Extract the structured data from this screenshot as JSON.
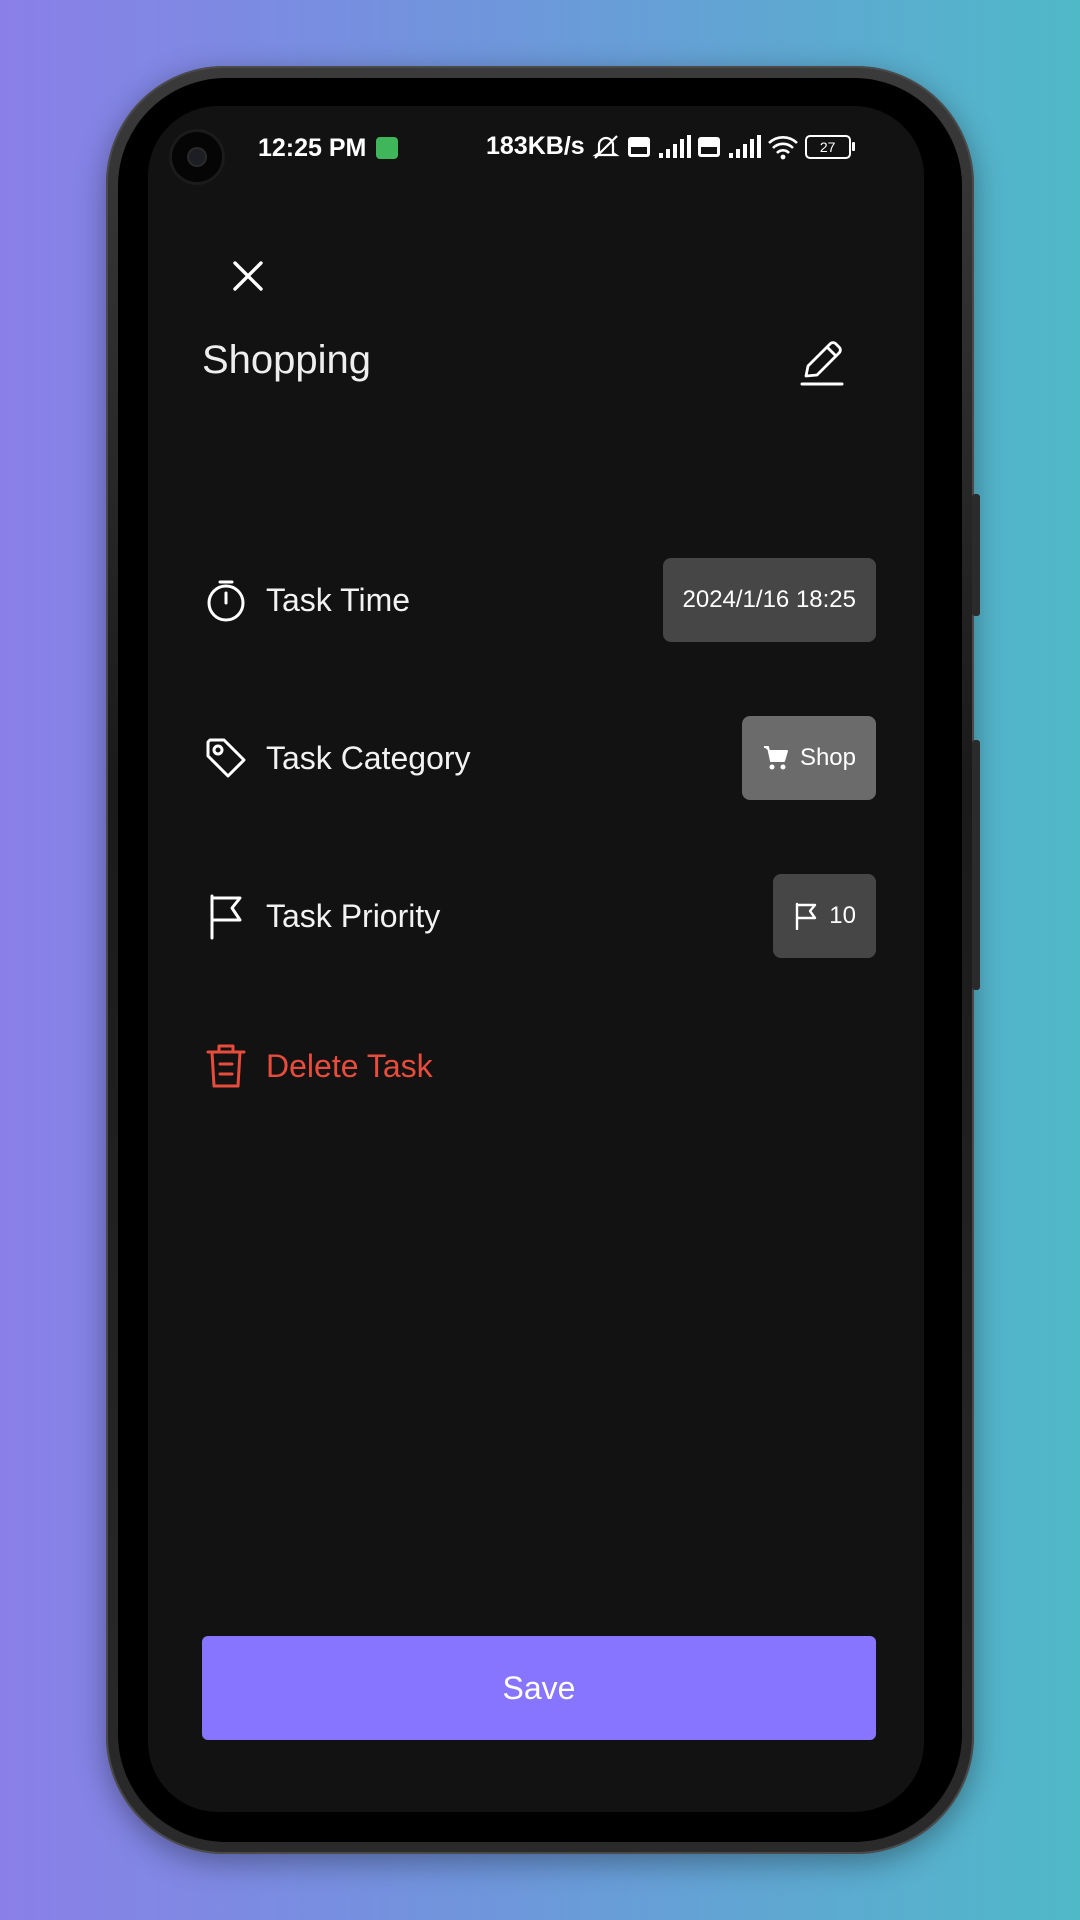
{
  "status_bar": {
    "time": "12:25 PM",
    "network_speed": "183KB/s",
    "battery": "27"
  },
  "header": {
    "close_icon": "close-icon",
    "title": "Shopping",
    "edit_icon": "edit-pen-icon"
  },
  "rows": {
    "time": {
      "label": "Task Time",
      "value": "2024/1/16 18:25",
      "icon": "timer-icon"
    },
    "category": {
      "label": "Task Category",
      "value": "Shop",
      "icon": "tag-icon",
      "chip_icon": "cart-icon"
    },
    "priority": {
      "label": "Task Priority",
      "value": "10",
      "icon": "flag-icon",
      "chip_icon": "flag-icon"
    },
    "delete": {
      "label": "Delete Task",
      "icon": "trash-icon"
    }
  },
  "footer": {
    "save_label": "Save"
  },
  "colors": {
    "background": "#121212",
    "accent": "#8875ff",
    "danger": "#e74c3c",
    "chip_dark": "#464646",
    "chip_light": "#6b6b6b"
  }
}
